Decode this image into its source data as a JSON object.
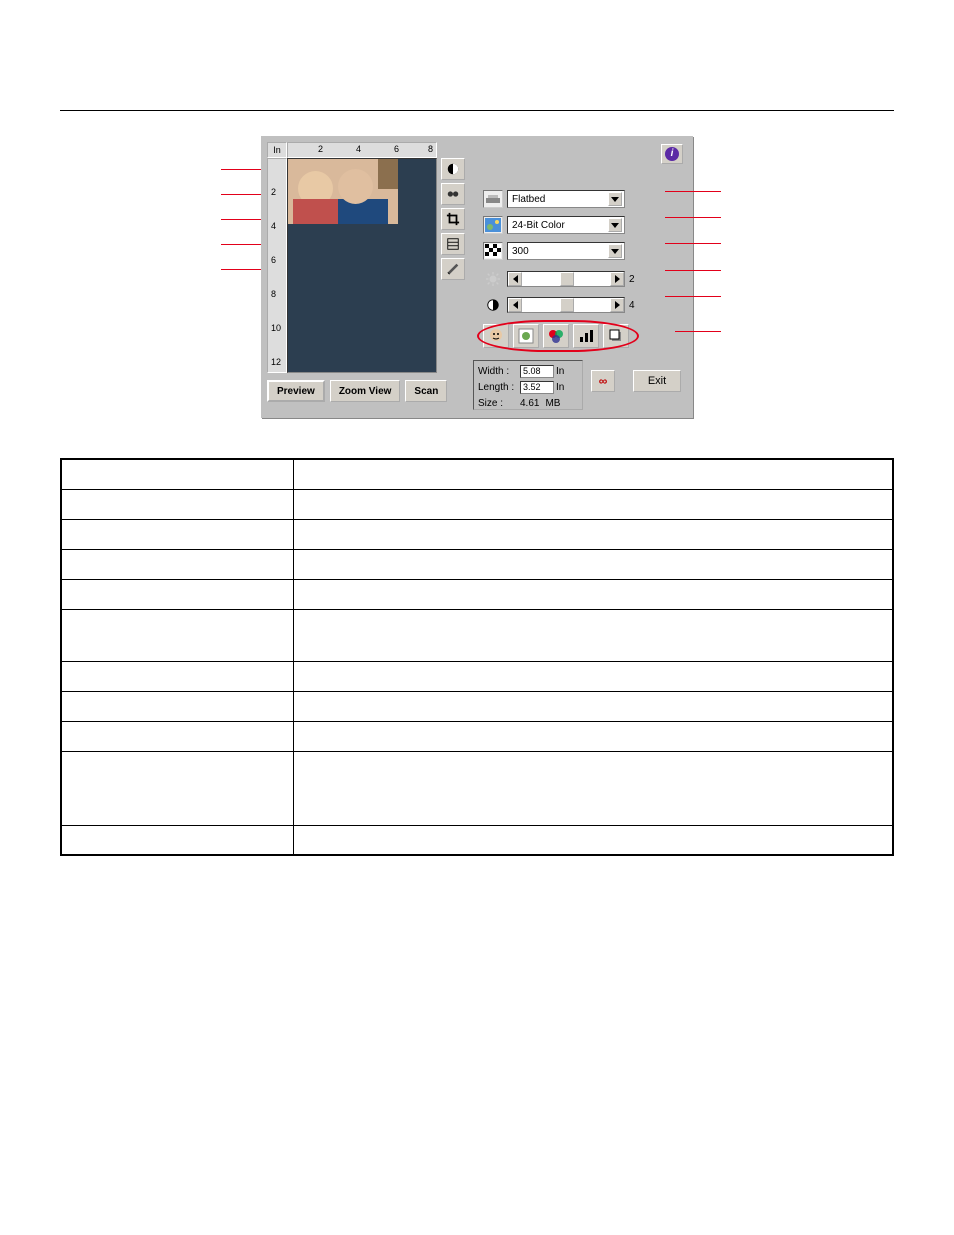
{
  "ruler_unit": "In",
  "ruler_top_marks": [
    "2",
    "4",
    "6",
    "8"
  ],
  "ruler_left_marks": [
    "2",
    "4",
    "6",
    "8",
    "10",
    "12"
  ],
  "tool_icons": [
    "invert-icon",
    "mirror-icon",
    "crop-icon",
    "autolevel-icon",
    "descreen-icon"
  ],
  "dropdowns": {
    "method": "Flatbed",
    "mode": "24-Bit Color",
    "resolution": "300"
  },
  "sliders": {
    "brightness": "2",
    "contrast": "4"
  },
  "imgtool_icons": [
    "face-icon",
    "colorbalance-icon",
    "hue-icon",
    "levels-icon",
    "drop-shadow-icon"
  ],
  "dims": {
    "width_label": "Width :",
    "width_value": "5.08",
    "length_label": "Length :",
    "length_value": "3.52",
    "size_label": "Size :",
    "size_value": "4.61",
    "unit_in": "In",
    "unit_mb": "MB"
  },
  "buttons": {
    "info": "i",
    "lock": "∞",
    "exit": "Exit",
    "preview": "Preview",
    "zoom": "Zoom View",
    "scan": "Scan"
  },
  "table": [
    {
      "h": ""
    },
    {
      "h": ""
    },
    {
      "h": ""
    },
    {
      "h": ""
    },
    {
      "h": ""
    },
    {
      "h": "",
      "cls": "tall"
    },
    {
      "h": ""
    },
    {
      "h": ""
    },
    {
      "h": ""
    },
    {
      "h": "",
      "cls": "xtall"
    },
    {
      "h": ""
    }
  ]
}
